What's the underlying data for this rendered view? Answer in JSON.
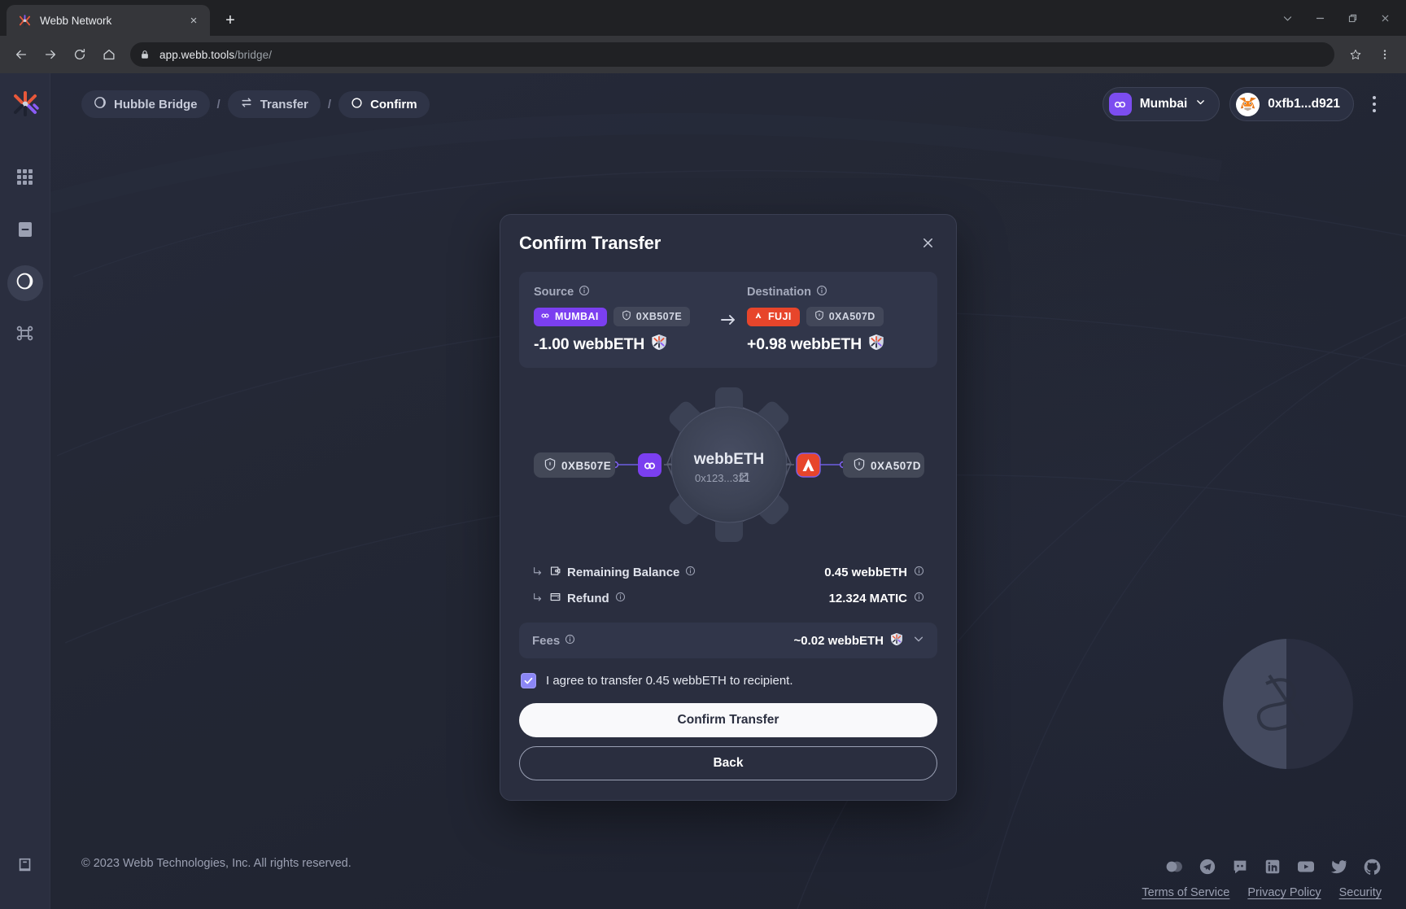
{
  "browser": {
    "tab": {
      "title": "Webb Network",
      "favicon": "webb-logo-icon",
      "close": "×"
    },
    "newtab_label": "+",
    "window_controls": [
      "chevron-down-icon",
      "minimize-icon",
      "maximize-icon",
      "close-icon"
    ],
    "nav": {
      "back": "back-icon",
      "forward": "forward-icon",
      "reload": "reload-icon",
      "home": "home-icon"
    },
    "address": {
      "domain": "app.webb.tools",
      "path": "/bridge/",
      "lock": "lock-icon"
    },
    "star": "star-icon",
    "menu": "browser-menu-icon"
  },
  "sidebar": {
    "logo": "webb-logo-icon",
    "items": [
      {
        "name": "apps",
        "icon": "grid-icon",
        "active": false
      },
      {
        "name": "statistics",
        "icon": "card-icon",
        "active": false
      },
      {
        "name": "bridge",
        "icon": "moon-circle-icon",
        "active": true
      },
      {
        "name": "network",
        "icon": "bridge-icon",
        "active": false
      }
    ],
    "bottom": {
      "name": "docs",
      "icon": "book-icon"
    }
  },
  "topbar": {
    "breadcrumbs": [
      {
        "label": "Hubble Bridge",
        "icon": "moon-circle-icon",
        "active": false
      },
      {
        "label": "Transfer",
        "icon": "transfer-arrows-icon",
        "active": false
      },
      {
        "label": "Confirm",
        "icon": "circle-icon",
        "active": true
      }
    ],
    "separator": "/",
    "network_selector": {
      "label": "Mumbai",
      "icon": "polygon-icon",
      "caret": "chevron-down-icon"
    },
    "wallet": {
      "label": "0xfb1...d921",
      "icon": "metamask-fox-icon"
    },
    "more": "kebab-menu-icon"
  },
  "modal": {
    "title": "Confirm Transfer",
    "close": "close-icon",
    "source": {
      "label": "Source",
      "info": "info-icon",
      "network": "MUMBAI",
      "network_icon": "polygon-icon",
      "address": "0XB507E",
      "address_icon": "shield-icon",
      "amount": "-1.00 webbETH",
      "token_icon": "webb-token-icon"
    },
    "arrow": "arrow-right-icon",
    "destination": {
      "label": "Destination",
      "info": "info-icon",
      "network": "FUJI",
      "network_icon": "avalanche-icon",
      "address": "0XA507D",
      "address_icon": "shield-icon",
      "amount": "+0.98 webbETH",
      "token_icon": "webb-token-icon"
    },
    "graphic": {
      "center_token": "webbETH",
      "center_address": "0x123...321",
      "external_link_icon": "external-link-icon",
      "left_chip": {
        "label": "0XB507E",
        "icon": "shield-icon"
      },
      "right_chip": {
        "label": "0XA507D",
        "icon": "shield-icon"
      },
      "left_node_icon": "polygon-icon",
      "right_node_icon": "avalanche-icon"
    },
    "details": [
      {
        "label": "Remaining Balance",
        "prefix_icon": "corner-arrow-icon",
        "row_icon": "wallet-icon",
        "info": "info-icon",
        "value": "0.45 webbETH",
        "value_info": "info-icon"
      },
      {
        "label": "Refund",
        "prefix_icon": "corner-arrow-icon",
        "row_icon": "refund-icon",
        "info": "info-icon",
        "value": "12.324 MATIC",
        "value_info": "info-icon"
      }
    ],
    "fees": {
      "label": "Fees",
      "info": "info-icon",
      "value": "~0.02 webbETH",
      "token_icon": "webb-token-icon",
      "caret": "chevron-down-icon"
    },
    "agreement": {
      "checked": true,
      "text": "I agree to transfer 0.45 webbETH to recipient."
    },
    "confirm_button": "Confirm Transfer",
    "back_button": "Back"
  },
  "footer": {
    "copyright": "© 2023 Webb Technologies, Inc. All rights reserved.",
    "socials": [
      "webb-commons-icon",
      "telegram-icon",
      "discord-icon",
      "linkedin-icon",
      "youtube-icon",
      "twitter-icon",
      "github-icon"
    ],
    "links": [
      "Terms of Service",
      "Privacy Policy",
      "Security"
    ]
  },
  "colors": {
    "accent_purple": "#7b3ff0",
    "accent_red": "#e7452b",
    "surface": "#2a2e3f",
    "surface_alt": "#31364a",
    "bg": "#252836",
    "text": "#ffffff",
    "text_muted": "#a6abbd"
  }
}
